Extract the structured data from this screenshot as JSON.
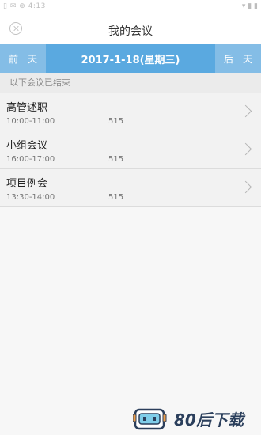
{
  "statusbar": {
    "left": "▯ ✉ ⊕ 4:13",
    "right": "▾ ▮ ▮"
  },
  "header": {
    "title": "我的会议"
  },
  "date_nav": {
    "prev_label": "前一天",
    "date": "2017-1-18(星期三)",
    "next_label": "后一天"
  },
  "notice": "以下会议已结束",
  "meetings": [
    {
      "name": "高管述职",
      "time": "10:00-11:00",
      "room": "515"
    },
    {
      "name": "小组会议",
      "time": "16:00-17:00",
      "room": "515"
    },
    {
      "name": "项目例会",
      "time": "13:30-14:00",
      "room": "515"
    }
  ],
  "watermark": {
    "text": "80后下载"
  },
  "colors": {
    "accent": "#5aa9e0",
    "accent_light": "#84bde6"
  }
}
